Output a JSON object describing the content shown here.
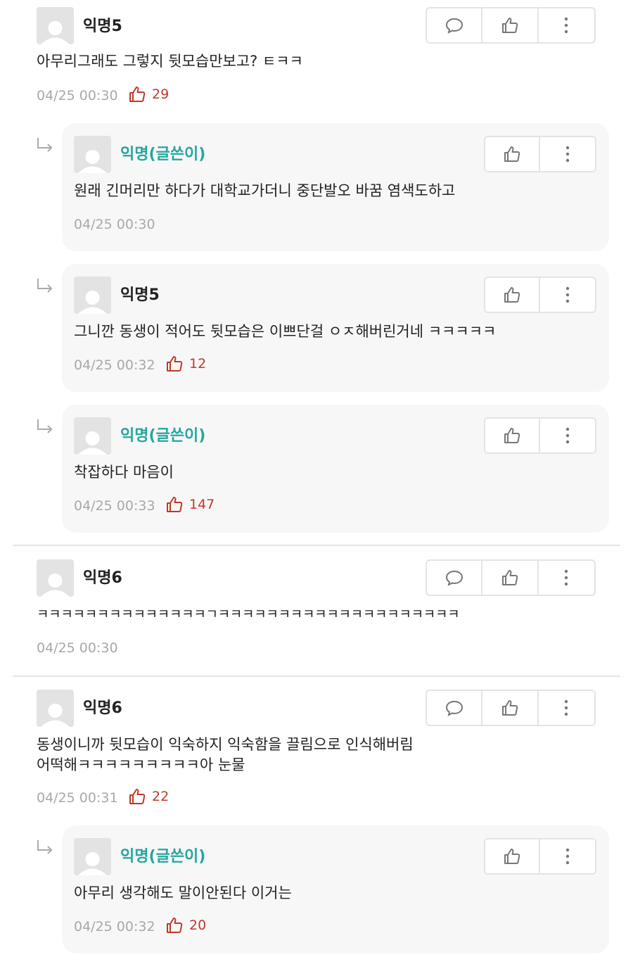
{
  "colors": {
    "author_name": "#26a6a0",
    "vote": "#c0392b",
    "meta": "#a8a8a8"
  },
  "icons": {
    "comment": "speech-bubble-icon",
    "like": "thumbs-up-icon",
    "more": "vertical-dots-icon",
    "reply": "reply-arrow-icon",
    "avatar": "default-avatar-icon"
  },
  "comments": [
    {
      "name": "익명5",
      "text": "아무리그래도 그렇지 뒷모습만보고? ㅌㅋㅋ",
      "time": "04/25 00:30",
      "votes": "29"
    },
    {
      "name": "익명(글쓴이)",
      "text": "원래 긴머리만 하다가 대학교가더니 중단발오 바꿈 염색도하고",
      "time": "04/25 00:30",
      "votes": ""
    },
    {
      "name": "익명5",
      "text": "그니깐 동생이 적어도 뒷모습은 이쁘단걸 ㅇㅈ해버린거네 ㅋㅋㅋㅋㅋ",
      "time": "04/25 00:32",
      "votes": "12"
    },
    {
      "name": "익명(글쓴이)",
      "text": "착잡하다 마음이",
      "time": "04/25 00:33",
      "votes": "147"
    },
    {
      "name": "익명6",
      "text": "ㅋㅋㅋㅋㅋㅋㅋㅋㅋㅋㅋㅋㅋㅋㄱㅋㅋㅋㅋㅋㅋㅋㅋㅋㅋㅋㅋㅋㅋㅋㅋㅋㅋㅋㅋ",
      "time": "04/25 00:30",
      "votes": ""
    },
    {
      "name": "익명6",
      "text_line1": "동생이니까 뒷모습이 익숙하지 익숙함을 끌림으로 인식해버림",
      "text_line2": "어떡해ㅋㅋㅋㅋㅋㅋㅋㅋㅋ아 눈물",
      "time": "04/25 00:31",
      "votes": "22"
    },
    {
      "name": "익명(글쓴이)",
      "text": "아무리 생각해도 말이안된다 이거는",
      "time": "04/25 00:32",
      "votes": "20"
    }
  ]
}
